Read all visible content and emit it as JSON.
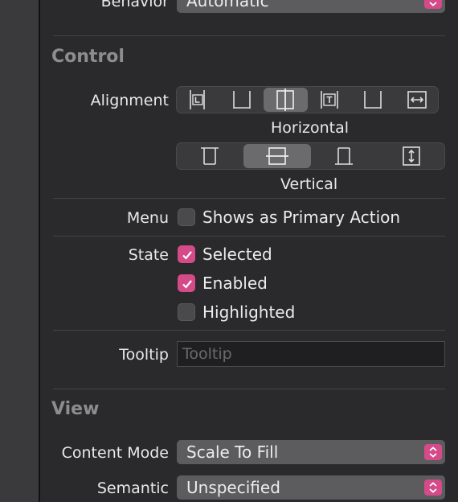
{
  "behavior": {
    "label": "Behavior",
    "value": "Automatic"
  },
  "control": {
    "title": "Control",
    "alignment_label": "Alignment",
    "horizontal_caption": "Horizontal",
    "vertical_caption": "Vertical",
    "horizontal_selected_index": 2,
    "vertical_selected_index": 1
  },
  "menu": {
    "label": "Menu",
    "option": "Shows as Primary Action",
    "checked": false
  },
  "state": {
    "label": "State",
    "options": [
      {
        "label": "Selected",
        "checked": true
      },
      {
        "label": "Enabled",
        "checked": true
      },
      {
        "label": "Highlighted",
        "checked": false
      }
    ]
  },
  "tooltip": {
    "label": "Tooltip",
    "placeholder": "Tooltip"
  },
  "view": {
    "title": "View",
    "content_mode_label": "Content Mode",
    "content_mode_value": "Scale To Fill",
    "semantic_label": "Semantic",
    "semantic_value": "Unspecified"
  },
  "colors": {
    "accent": "#d54a88",
    "background": "#2a292b",
    "control": "#5c5b5e"
  }
}
